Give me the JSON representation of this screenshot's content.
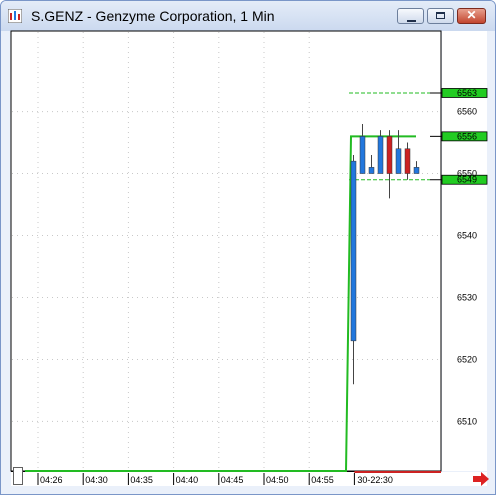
{
  "window": {
    "title": "S.GENZ - Genzyme Corporation, 1 Min",
    "controls": [
      "minimize-icon",
      "maximize-icon",
      "close-icon"
    ]
  },
  "colors": {
    "up_candle": "#2277dd",
    "down_candle": "#cc2222",
    "line": "#22bb22",
    "price_tag": "#22cc22",
    "scroll_arrow": "#dd2222"
  },
  "chart_data": {
    "type": "candlestick",
    "title": "",
    "xlabel": "",
    "ylabel": "",
    "ylim": [
      6502,
      6573
    ],
    "price_ticks": [
      "6560",
      "6550",
      "6540",
      "6530",
      "6520",
      "6510"
    ],
    "time_ticks": [
      "04:26",
      "04:30",
      "04:35",
      "04:40",
      "04:45",
      "04:50",
      "04:55"
    ],
    "session_label": "30-22:30",
    "price_tags": [
      {
        "label": "6563",
        "value": 6563,
        "style": "dashed"
      },
      {
        "label": "6556",
        "value": 6556,
        "style": "solid"
      },
      {
        "label": "6549",
        "value": 6549,
        "style": "dashed"
      }
    ],
    "line": [
      6502,
      6502,
      6556,
      6556
    ],
    "candles": [
      {
        "open": 6523,
        "high": 6553,
        "low": 6516,
        "close": 6552
      },
      {
        "open": 6550,
        "high": 6558,
        "low": 6550,
        "close": 6556
      },
      {
        "open": 6550,
        "high": 6553,
        "low": 6550,
        "close": 6551
      },
      {
        "open": 6550,
        "high": 6557,
        "low": 6550,
        "close": 6556
      },
      {
        "open": 6556,
        "high": 6557,
        "low": 6546,
        "close": 6550
      },
      {
        "open": 6550,
        "high": 6557,
        "low": 6550,
        "close": 6554
      },
      {
        "open": 6554,
        "high": 6555,
        "low": 6549,
        "close": 6550
      },
      {
        "open": 6550,
        "high": 6552,
        "low": 6550,
        "close": 6551
      }
    ]
  }
}
